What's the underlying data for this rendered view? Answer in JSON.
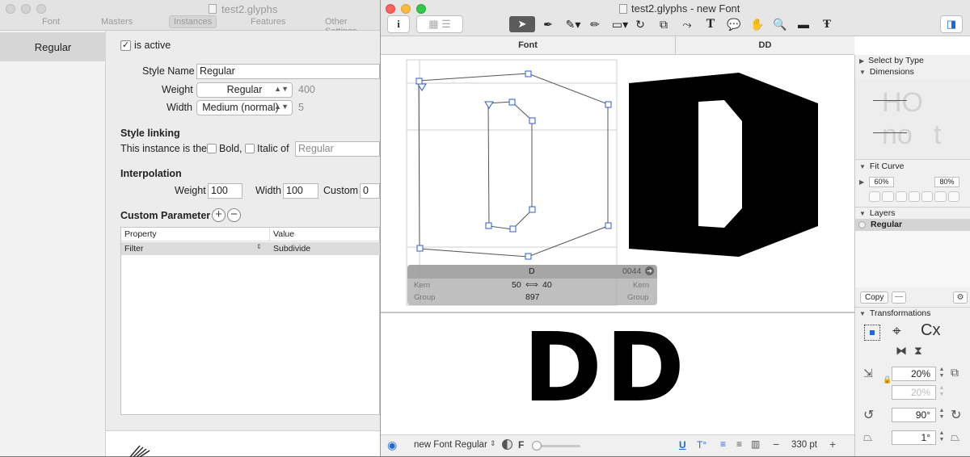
{
  "bg_window": {
    "title": "test2.glyphs",
    "tabs": [
      "Font",
      "Masters",
      "Instances",
      "Features",
      "Other Settings"
    ],
    "selected_tab": "Instances",
    "sidebar_selected": "Regular",
    "is_active_label": "is active",
    "style_name_label": "Style Name",
    "style_name_value": "Regular",
    "weight_label": "Weight",
    "weight_value": "Regular",
    "weight_number": "400",
    "width_label": "Width",
    "width_value": "Medium (normal)",
    "width_number": "5",
    "style_linking_heading": "Style linking",
    "style_linking_text": "This instance is the",
    "bold_label": "Bold,",
    "italic_label": "Italic of",
    "italic_of_placeholder": "Regular",
    "interpolation_heading": "Interpolation",
    "interp_weight_label": "Weight",
    "interp_weight_value": "100",
    "interp_width_label": "Width",
    "interp_width_value": "100",
    "interp_custom_label": "Custom",
    "interp_custom_value": "0",
    "custom_param_heading": "Custom Parameter",
    "table_headers": [
      "Property",
      "Value"
    ],
    "table_rows": [
      {
        "property": "Filter",
        "value": "Subdivide"
      }
    ]
  },
  "main_window": {
    "title": "test2.glyphs - new Font",
    "tabs": [
      "Font",
      "DD"
    ],
    "info_box": {
      "glyph_name": "D",
      "unicode": "0044",
      "kern_left_label": "Kern",
      "kern_right_label": "Kern",
      "lsb": "50",
      "rsb": "40",
      "group_left_label": "Group",
      "group_right_label": "Group",
      "width": "897"
    },
    "preview_text": "DD",
    "bottom": {
      "font_selector": "new Font Regular",
      "f_label": "F",
      "zoom_value": "330 pt"
    }
  },
  "right_panel": {
    "select_by_type": "Select by Type",
    "dimensions": "Dimensions",
    "dim_letters": [
      "HO",
      "no",
      "t"
    ],
    "fit_curve": "Fit Curve",
    "fit_low": "60%",
    "fit_high": "80%",
    "layers": "Layers",
    "layer_selected": "Regular",
    "copy_button": "Copy",
    "transformations": "Transformations",
    "scale_value": "20%",
    "scale_value2": "20%",
    "rotate_value": "90°",
    "slant_value": "1°",
    "cx_label": "Cx"
  },
  "colors": {
    "close": "#fc605c",
    "minimize": "#fdbc40",
    "zoom": "#34c84a",
    "node_blue": "#2b5bd7",
    "accent_blue": "#1c6ad6"
  }
}
